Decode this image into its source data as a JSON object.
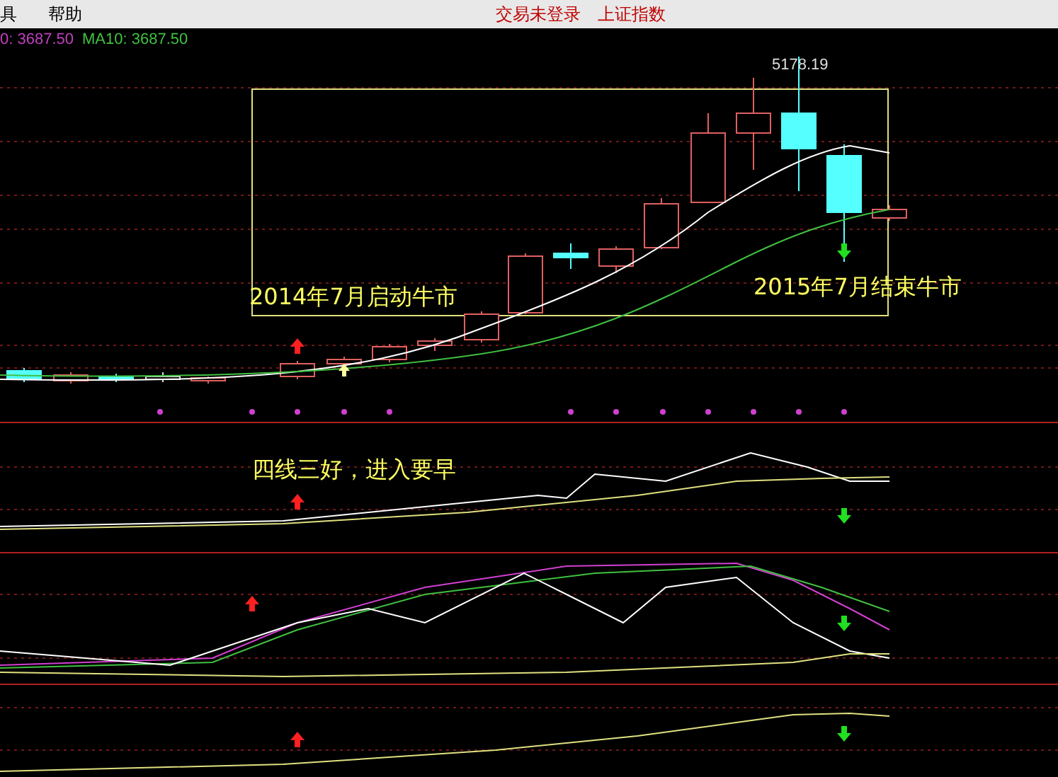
{
  "menu": [
    {
      "label": "具"
    },
    {
      "label": "帮助"
    }
  ],
  "status": {
    "login": "交易未登录",
    "index": "上证指数"
  },
  "legend": [
    {
      "label": "0: 3687.50",
      "color": "#c040c0"
    },
    {
      "label": "MA10: 3687.50",
      "color": "#40c040"
    }
  ],
  "main_panel": {
    "high_label": "5178.19",
    "annotations": [
      "2014年7月启动牛市",
      "2015年7月结束牛市"
    ]
  },
  "indicator_panel": {
    "annotation": "四线三好，进入要早"
  }
}
